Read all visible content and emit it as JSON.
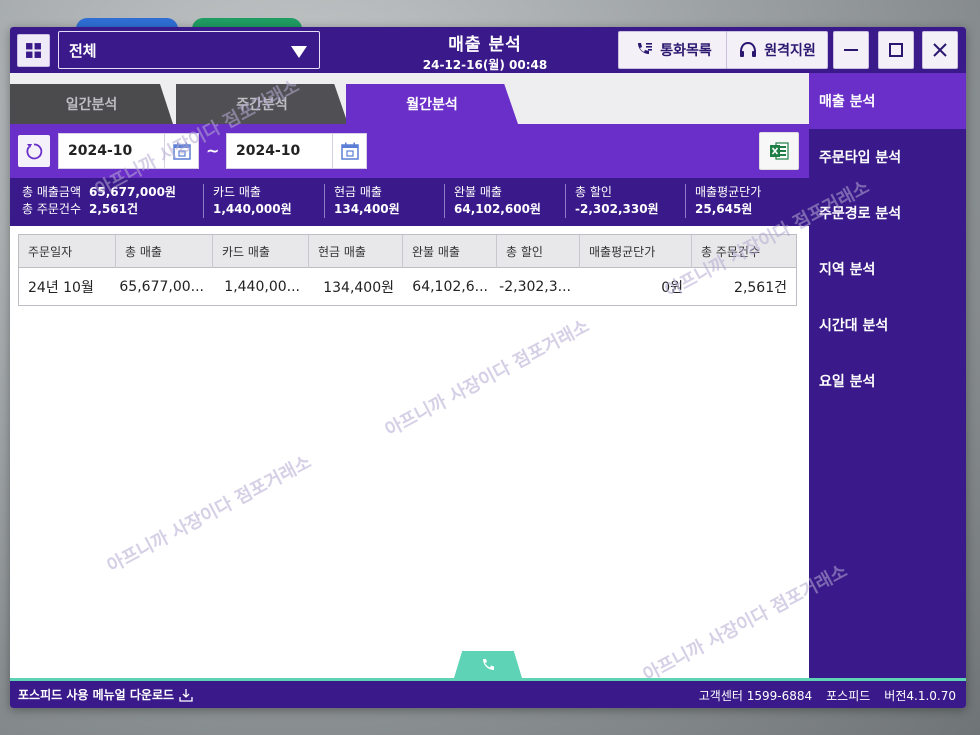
{
  "titlebar": {
    "store_select_value": "전체",
    "title": "매출 분석",
    "datetime": "24-12-16(월) 00:48",
    "call_log_label": "통화목록",
    "remote_support_label": "원격지원"
  },
  "tabs": [
    {
      "label": "일간분석",
      "active": false
    },
    {
      "label": "주간분석",
      "active": false
    },
    {
      "label": "월간분석",
      "active": true
    }
  ],
  "filter": {
    "date_from": "2024-10",
    "date_to": "2024-10",
    "separator": "~"
  },
  "summary": {
    "total_sales_label": "총 매출금액",
    "total_sales_value": "65,677,000원",
    "total_orders_label": "총 주문건수",
    "total_orders_value": "2,561건",
    "items": [
      {
        "label": "카드 매출",
        "value": "1,440,000원"
      },
      {
        "label": "현금 매출",
        "value": "134,400원"
      },
      {
        "label": "완불 매출",
        "value": "64,102,600원"
      },
      {
        "label": "총 할인",
        "value": "-2,302,330원"
      },
      {
        "label": "매출평균단가",
        "value": "25,645원"
      }
    ]
  },
  "table": {
    "headers": [
      "주문일자",
      "총 매출",
      "카드 매출",
      "현금 매출",
      "완불 매출",
      "총 할인",
      "매출평균단가",
      "총 주문건수"
    ],
    "rows": [
      [
        "24년 10월",
        "65,677,00...",
        "1,440,00...",
        "134,400원",
        "64,102,6...",
        "-2,302,3...",
        "0원",
        "2,561건"
      ]
    ]
  },
  "sidebar": {
    "items": [
      {
        "label": "매출 분석",
        "active": true
      },
      {
        "label": "주문타입 분석",
        "active": false
      },
      {
        "label": "주문경로 분석",
        "active": false
      },
      {
        "label": "지역 분석",
        "active": false
      },
      {
        "label": "시간대 분석",
        "active": false
      },
      {
        "label": "요일 분석",
        "active": false
      }
    ]
  },
  "footer": {
    "manual_download": "포스피드 사용 메뉴얼 다운로드",
    "customer_center": "고객센터 1599-6884",
    "brand": "포스피드",
    "version": "버전4.1.0.70"
  },
  "watermark_text": "아프니까 사장이다 점포거래소",
  "colors": {
    "primary_dark": "#3a1a8a",
    "primary": "#6b2fc9",
    "accent_mint": "#5fd3b5",
    "excel_green": "#1e7e45"
  }
}
